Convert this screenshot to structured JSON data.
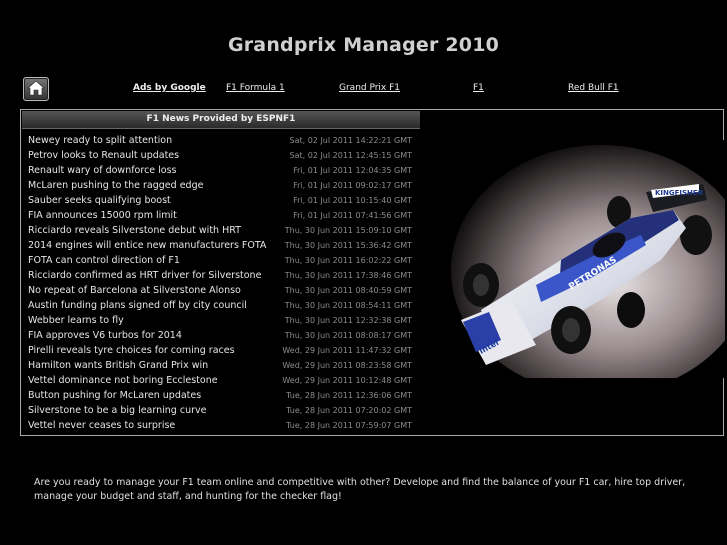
{
  "site": {
    "title": "Grandprix Manager 2010"
  },
  "nav": {
    "home_icon": "home-icon",
    "ads_label": "Ads by Google",
    "links": [
      "F1 Formula 1",
      "Grand Prix F1",
      "F1",
      "Red Bull F1"
    ]
  },
  "news": {
    "header": "F1 News Provided by ESPNF1",
    "items": [
      {
        "title": "Newey ready to split attention",
        "date": "Sat, 02 Jul 2011 14:22:21 GMT"
      },
      {
        "title": "Petrov looks to Renault updates",
        "date": "Sat, 02 Jul 2011 12:45:15 GMT"
      },
      {
        "title": "Renault wary of downforce loss",
        "date": "Fri, 01 Jul 2011 12:04:35 GMT"
      },
      {
        "title": "McLaren pushing to the ragged edge",
        "date": "Fri, 01 Jul 2011 09:02:17 GMT"
      },
      {
        "title": "Sauber seeks qualifying boost",
        "date": "Fri, 01 Jul 2011 10:15:40 GMT"
      },
      {
        "title": "FIA announces 15000 rpm limit",
        "date": "Fri, 01 Jul 2011 07:41:56 GMT"
      },
      {
        "title": "Ricciardo reveals Silverstone debut with HRT",
        "date": "Thu, 30 Jun 2011 15:09:10 GMT"
      },
      {
        "title": "2014 engines will entice new manufacturers FOTA",
        "date": "Thu, 30 Jun 2011 15:36:42 GMT"
      },
      {
        "title": "FOTA can control direction of F1",
        "date": "Thu, 30 Jun 2011 16:02:22 GMT"
      },
      {
        "title": "Ricciardo confirmed as HRT driver for Silverstone",
        "date": "Thu, 30 Jun 2011 17:38:46 GMT"
      },
      {
        "title": "No repeat of Barcelona at Silverstone Alonso",
        "date": "Thu, 30 Jun 2011 08:40:59 GMT"
      },
      {
        "title": "Austin funding plans signed off by city council",
        "date": "Thu, 30 Jun 2011 08:54:11 GMT"
      },
      {
        "title": "Webber learns to fly",
        "date": "Thu, 30 Jun 2011 12:32:38 GMT"
      },
      {
        "title": "FIA approves V6 turbos for 2014",
        "date": "Thu, 30 Jun 2011 08:08:17 GMT"
      },
      {
        "title": "Pirelli reveals tyre choices for coming races",
        "date": "Wed, 29 Jun 2011 11:47:32 GMT"
      },
      {
        "title": "Hamilton wants British Grand Prix win",
        "date": "Wed, 29 Jun 2011 08:23:58 GMT"
      },
      {
        "title": "Vettel dominance not boring Ecclestone",
        "date": "Wed, 29 Jun 2011 10:12:48 GMT"
      },
      {
        "title": "Button pushing for McLaren updates",
        "date": "Tue, 28 Jun 2011 12:36:06 GMT"
      },
      {
        "title": "Silverstone to be a big learning curve",
        "date": "Tue, 28 Jun 2011 07:20:02 GMT"
      },
      {
        "title": "Vettel never ceases to surprise",
        "date": "Tue, 28 Jun 2011 07:59:07 GMT"
      }
    ]
  },
  "car_image": {
    "sponsor_texts": [
      "KINGFISHER",
      "PETRONAS",
      "Intel"
    ]
  },
  "intro": {
    "text": "Are you ready to manage your F1 team online and competitive with other? Develope and find the balance of your F1 car, hire top driver, manage your budget and staff, and hunting for the checker flag!"
  },
  "colors": {
    "background": "#000000",
    "text": "#e0e0e0",
    "date_text": "#8c8c8c",
    "border": "#aaaaaa"
  }
}
